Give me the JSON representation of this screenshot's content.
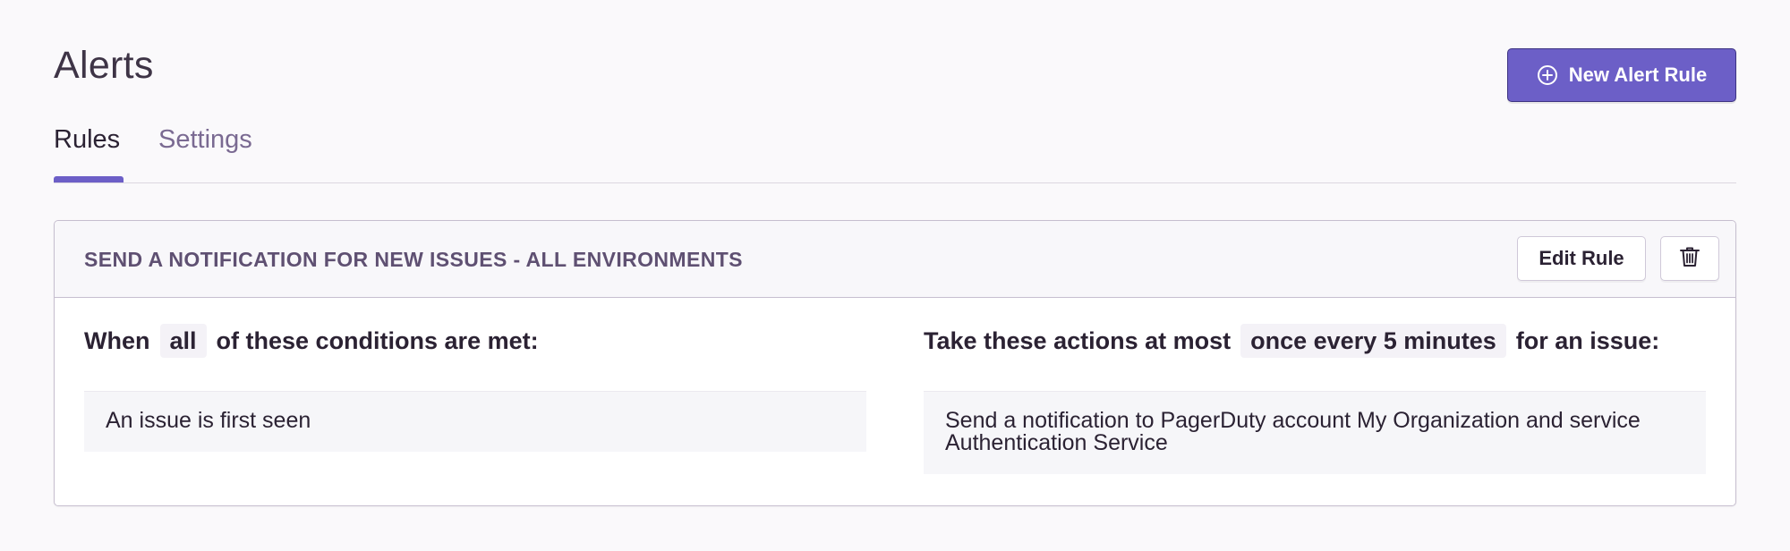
{
  "page": {
    "title": "Alerts",
    "new_rule_button": "New Alert Rule"
  },
  "tabs": [
    {
      "label": "Rules",
      "active": true
    },
    {
      "label": "Settings",
      "active": false
    }
  ],
  "rule": {
    "title": "SEND A NOTIFICATION FOR NEW ISSUES - ALL ENVIRONMENTS",
    "edit_button": "Edit Rule",
    "delete_icon": "trash-icon",
    "conditions": {
      "prefix": "When",
      "match": "all",
      "suffix": "of these conditions are met:",
      "items": [
        "An issue is first seen"
      ]
    },
    "actions": {
      "prefix": "Take these actions at most",
      "frequency": "once every 5 minutes",
      "suffix": "for an issue:",
      "items": [
        "Send a notification to PagerDuty account My Organization and service Authentication Service"
      ]
    }
  },
  "colors": {
    "accent": "#6c5fc7",
    "background": "#faf9fb",
    "border": "#c6becf",
    "muted_text": "#7a6a92"
  }
}
